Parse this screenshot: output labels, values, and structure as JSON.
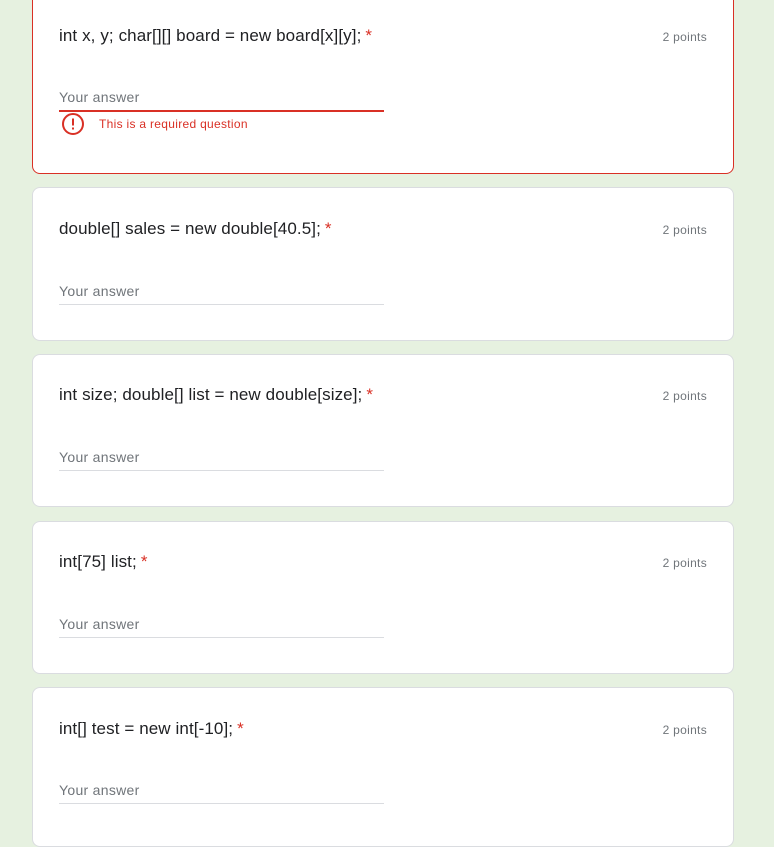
{
  "questions": [
    {
      "title": "int x, y; char[][] board = new board[x][y];",
      "required_mark": "*",
      "points": "2 points",
      "placeholder": "Your answer",
      "error": "This is a required question"
    },
    {
      "title": "double[] sales = new double[40.5];",
      "required_mark": "*",
      "points": "2 points",
      "placeholder": "Your answer"
    },
    {
      "title": "int size; double[] list = new double[size];",
      "required_mark": "*",
      "points": "2 points",
      "placeholder": "Your answer"
    },
    {
      "title": "int[75] list;",
      "required_mark": "*",
      "points": "2 points",
      "placeholder": "Your answer"
    },
    {
      "title": "int[] test = new int[-10];",
      "required_mark": "*",
      "points": "2 points",
      "placeholder": "Your answer"
    }
  ],
  "colors": {
    "background": "#e6f1e0",
    "error": "#d93025",
    "card": "#ffffff"
  },
  "icons": {
    "error": "error-circle-exclamation-icon"
  }
}
